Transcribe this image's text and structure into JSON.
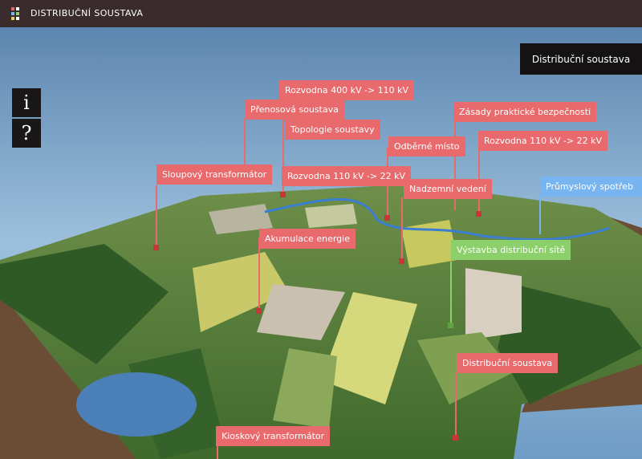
{
  "app": {
    "title": "DISTRIBUČNÍ SOUSTAVA"
  },
  "sidebar": {
    "info_label": "i",
    "help_label": "?"
  },
  "panel": {
    "title": "Distribuční soustava"
  },
  "hotspots": [
    {
      "label": "Rozvodna 400 kV -> 110 kV",
      "color": "#e86a6c"
    },
    {
      "label": "Přenosová soustava",
      "color": "#e86a6c"
    },
    {
      "label": "Topologie soustavy",
      "color": "#e86a6c"
    },
    {
      "label": "Zásady praktické bezpečnosti",
      "color": "#e86a6c"
    },
    {
      "label": "Odběrné místo",
      "color": "#e86a6c"
    },
    {
      "label": "Rozvodna 110 kV -> 22 kV",
      "color": "#e86a6c"
    },
    {
      "label": "Sloupový transformátor",
      "color": "#e86a6c"
    },
    {
      "label": "Rozvodna 110 kV -> 22 kV",
      "color": "#e86a6c"
    },
    {
      "label": "Nadzemní vedení",
      "color": "#e86a6c"
    },
    {
      "label": "Průmyslový spotřeb",
      "color": "#78b4ef"
    },
    {
      "label": "Akumulace energie",
      "color": "#e86a6c"
    },
    {
      "label": "Výstavba distribuční sítě",
      "color": "#8bd06a"
    },
    {
      "label": "Distribuční soustava",
      "color": "#e86a6c"
    },
    {
      "label": "Kioskový transformátor",
      "color": "#e86a6c"
    }
  ],
  "colors": {
    "topbar": "#3a2b2c",
    "hotspot_red": "#e86a6c",
    "hotspot_green": "#8bd06a",
    "hotspot_blue": "#78b4ef",
    "sky": "#7fa6c9"
  }
}
